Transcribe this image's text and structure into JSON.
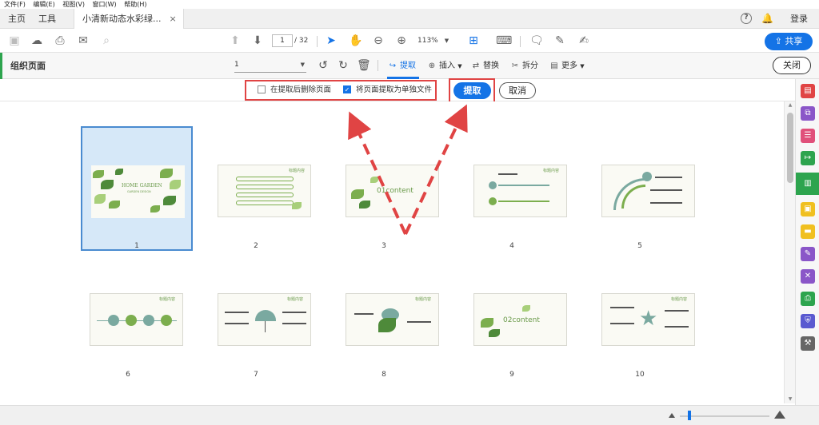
{
  "menu": [
    "文件(F)",
    "编辑(E)",
    "视图(V)",
    "窗口(W)",
    "帮助(H)"
  ],
  "tabs": {
    "home": "主页",
    "tools": "工具",
    "doc": "小清新动态水彩绿...",
    "close": "×"
  },
  "header": {
    "login": "登录"
  },
  "toolbar": {
    "page_current": "1",
    "page_total": "/ 32",
    "zoom": "113%",
    "share": "共享"
  },
  "organize": {
    "title": "组织页面",
    "page_select": "1",
    "items": {
      "extract": "提取",
      "insert": "插入",
      "replace": "替换",
      "split": "拆分",
      "more": "更多"
    },
    "close": "关闭"
  },
  "options": {
    "delete_after": "在提取后删除页面",
    "delete_after_checked": false,
    "separate_files": "将页面提取为单独文件",
    "separate_files_checked": true,
    "extract_btn": "提取",
    "cancel_btn": "取消"
  },
  "pages": [
    {
      "n": "1",
      "selected": true,
      "text": "HOME GARDEN",
      "sub": "GARDEN DESIGN"
    },
    {
      "n": "2",
      "selected": false,
      "text": "标题内容"
    },
    {
      "n": "3",
      "selected": false,
      "text": "01content"
    },
    {
      "n": "4",
      "selected": false,
      "text": "标题内容"
    },
    {
      "n": "5",
      "selected": false
    },
    {
      "n": "6",
      "selected": false,
      "text": "标题内容"
    },
    {
      "n": "7",
      "selected": false,
      "text": "标题内容"
    },
    {
      "n": "8",
      "selected": false,
      "text": "标题内容"
    },
    {
      "n": "9",
      "selected": false,
      "text": "02content"
    },
    {
      "n": "10",
      "selected": false,
      "text": "标题内容"
    }
  ],
  "colors": {
    "accent": "#1473e6",
    "highlight": "#e04444",
    "green": "#2da44e"
  }
}
